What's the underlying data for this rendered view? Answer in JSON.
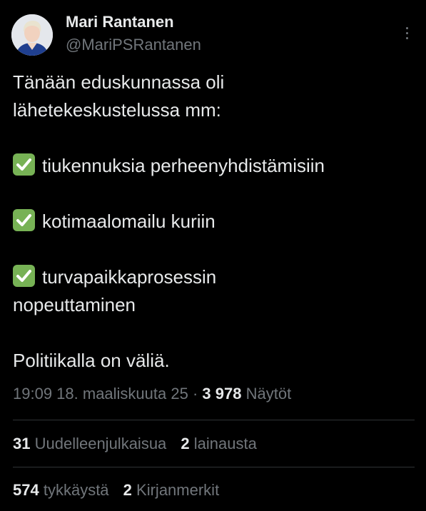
{
  "author": {
    "name": "Mari Rantanen",
    "handle": "@MariPSRantanen"
  },
  "tweet": {
    "line1": "Tänään eduskunnassa oli",
    "line2": "lähetekeskustelussa mm:",
    "item1": "tiukennuksia perheenyhdistämisiin",
    "item2": "kotimaalomailu kuriin",
    "item3_line1": "turvapaikkaprosessin",
    "item3_line2": "nopeuttaminen",
    "closing": "Politiikalla on väliä.",
    "bullet_icon": "check-mark-button-emoji"
  },
  "meta": {
    "timestamp": "19:09 18. maaliskuuta 25",
    "separator": "·",
    "views_count": "3 978",
    "views_label": "Näytöt"
  },
  "stats": {
    "retweets_count": "31",
    "retweets_label": "Uudelleenjulkaisua",
    "quotes_count": "2",
    "quotes_label": "lainausta",
    "likes_count": "574",
    "likes_label": "tykkäystä",
    "bookmarks_count": "2",
    "bookmarks_label": "Kirjanmerkit"
  },
  "colors": {
    "background": "#000000",
    "text_primary": "#e7e9ea",
    "text_secondary": "#71767b",
    "divider": "#2f3336",
    "check_emoji": "#77b255"
  }
}
